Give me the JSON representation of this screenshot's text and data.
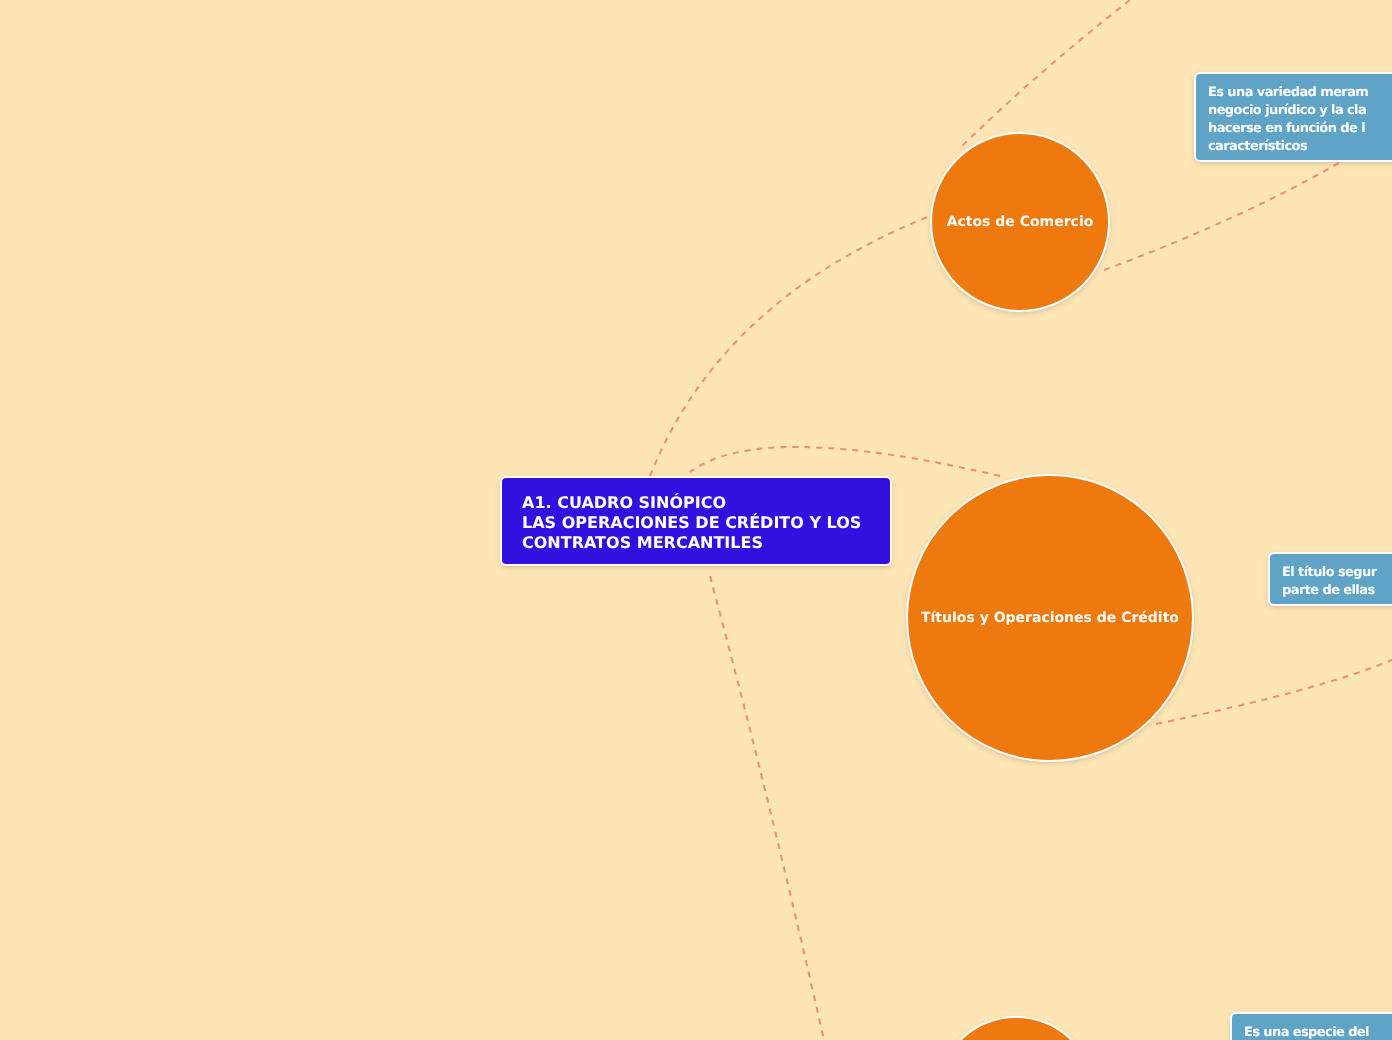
{
  "nodes": [
    {
      "kind": "root",
      "lines": [
        "A1. CUADRO SINÓPICO",
        "LAS OPERACIONES DE CRÉDITO Y LOS",
        "CONTRATOS MERCANTILES"
      ]
    },
    {
      "kind": "circle",
      "lines": [
        "Actos de Comercio"
      ]
    },
    {
      "kind": "note",
      "lines": [
        "Es una variedad meram",
        "negocio jurídico y la cla",
        "hacerse en función de l",
        "característicos"
      ]
    },
    {
      "kind": "circle",
      "lines": [
        "Títulos y Operaciones de Crédito"
      ]
    },
    {
      "kind": "note",
      "lines": [
        "El título segur",
        "parte de ellas"
      ]
    },
    {
      "kind": "circle"
    },
    {
      "kind": "note",
      "lines": [
        "Es una especie del"
      ]
    }
  ]
}
